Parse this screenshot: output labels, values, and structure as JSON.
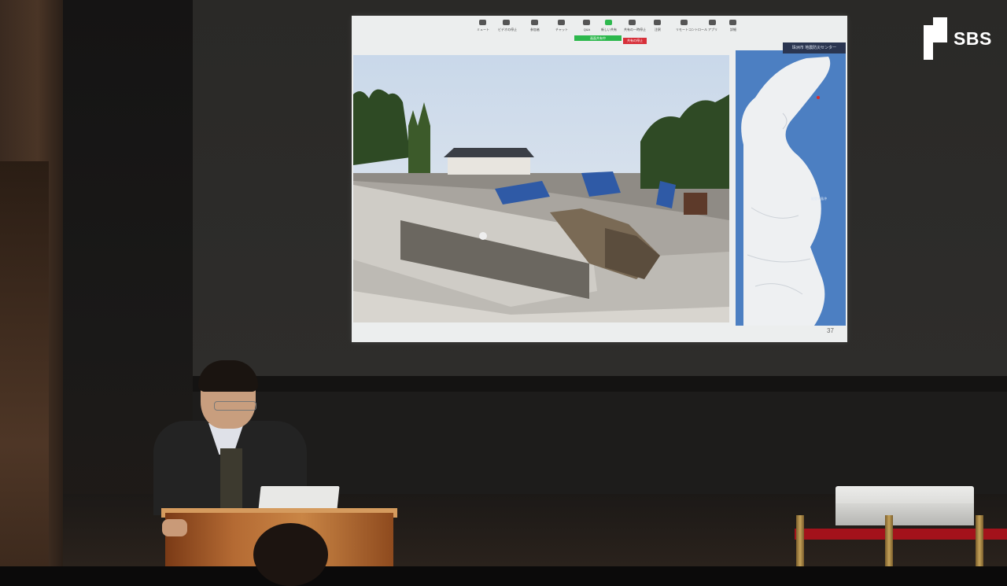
{
  "slide": {
    "zoom_toolbar": [
      {
        "label": "ミュート",
        "icon": "microphone-icon"
      },
      {
        "label": "ビデオの停止",
        "icon": "video-icon"
      },
      {
        "label": "参加者",
        "icon": "participants-icon"
      },
      {
        "label": "チャット",
        "icon": "chat-icon"
      },
      {
        "label": "Q&A",
        "icon": "qa-icon"
      },
      {
        "label": "新しい共有",
        "icon": "share-icon"
      },
      {
        "label": "共有の一時停止",
        "icon": "pause-icon"
      },
      {
        "label": "注釈",
        "icon": "annotate-icon"
      },
      {
        "label": "リモートコントロール",
        "icon": "remote-control-icon"
      },
      {
        "label": "アプリ",
        "icon": "apps-icon"
      },
      {
        "label": "詳細",
        "icon": "more-icon"
      }
    ],
    "sharing_indicator": "画面共有中",
    "stop_share_label": "共有の停止",
    "map_header": "珠洲市 地震防災センター",
    "map_label": "能登半島沖",
    "page_number": "37"
  },
  "logo": {
    "text": "SBS"
  },
  "colors": {
    "zoom_green": "#2db84d",
    "zoom_red": "#d7303a",
    "map_sea": "#4c7fc2",
    "map_land": "#eef0f2"
  }
}
